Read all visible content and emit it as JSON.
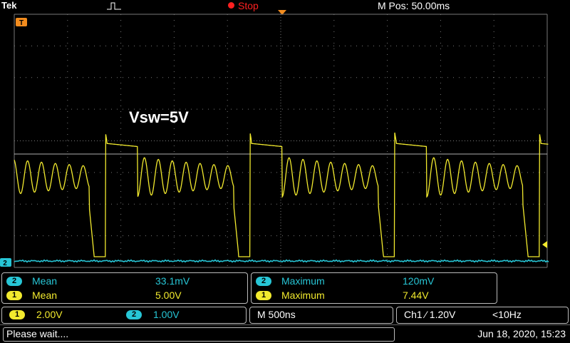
{
  "colors": {
    "ch1": "#f2ea2e",
    "ch2": "#27c6d6",
    "stop": "#ff2020",
    "grid": "#777777",
    "trigger_marker": "#f28c1e"
  },
  "header": {
    "brand": "Tek",
    "status": "Stop",
    "mpos": "M Pos: 50.00ms"
  },
  "annotation": "Vsw=5V",
  "markers": {
    "trigger_level_tag": "T",
    "ch2_ground_tag": "2"
  },
  "measurements": {
    "left": [
      {
        "ch": "2",
        "label": "Mean",
        "value": "33.1mV"
      },
      {
        "ch": "1",
        "label": "Mean",
        "value": "5.00V"
      }
    ],
    "right": [
      {
        "ch": "2",
        "label": "Maximum",
        "value": "120mV"
      },
      {
        "ch": "1",
        "label": "Maximum",
        "value": "7.44V"
      }
    ]
  },
  "settings": {
    "ch1_scale": "2.00V",
    "ch2_scale": "1.00V",
    "timebase": "M 500ns",
    "trigger": "Ch1 ⁄ 1.20V",
    "freq": "<10Hz"
  },
  "status": {
    "message": "Please wait....",
    "datetime": "Jun 18, 2020, 15:23"
  }
}
